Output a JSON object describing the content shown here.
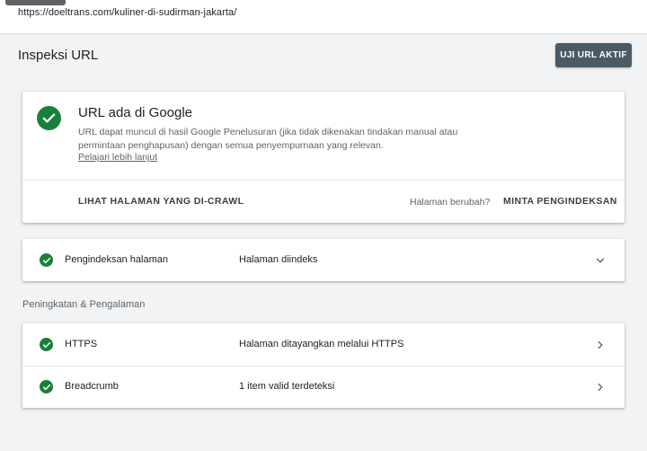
{
  "address": {
    "url": "https://doeltrans.com/kuliner-di-sudirman-jakarta/"
  },
  "header": {
    "title": "Inspeksi URL",
    "test_live_label": "UJI URL AKTIF"
  },
  "status_card": {
    "title": "URL ada di Google",
    "description": "URL dapat muncul di hasil Google Penelusuran (jika tidak dikenakan tindakan manual atau permintaan penghapusan) dengan semua penyempurnaan yang relevan.",
    "learn_more": "Pelajari lebih lanjut",
    "view_crawled_label": "LIHAT HALAMAN YANG DI-CRAWL",
    "page_changed_text": "Halaman berubah?",
    "request_indexing_label": "MINTA PENGINDEKSAN",
    "icon": "check-circle-icon"
  },
  "indexing": {
    "label": "Pengindeksan halaman",
    "value": "Halaman diindeks",
    "icon": "check-circle-icon"
  },
  "enhancements": {
    "heading": "Peningkatan & Pengalaman",
    "items": [
      {
        "label": "HTTPS",
        "value": "Halaman ditayangkan melalui HTTPS",
        "icon": "check-circle-icon"
      },
      {
        "label": "Breadcrumb",
        "value": "1 item valid terdeteksi",
        "icon": "check-circle-icon"
      }
    ]
  },
  "colors": {
    "success": "#188038",
    "primary_button": "#4a5a66",
    "background": "#f1f3f4"
  }
}
